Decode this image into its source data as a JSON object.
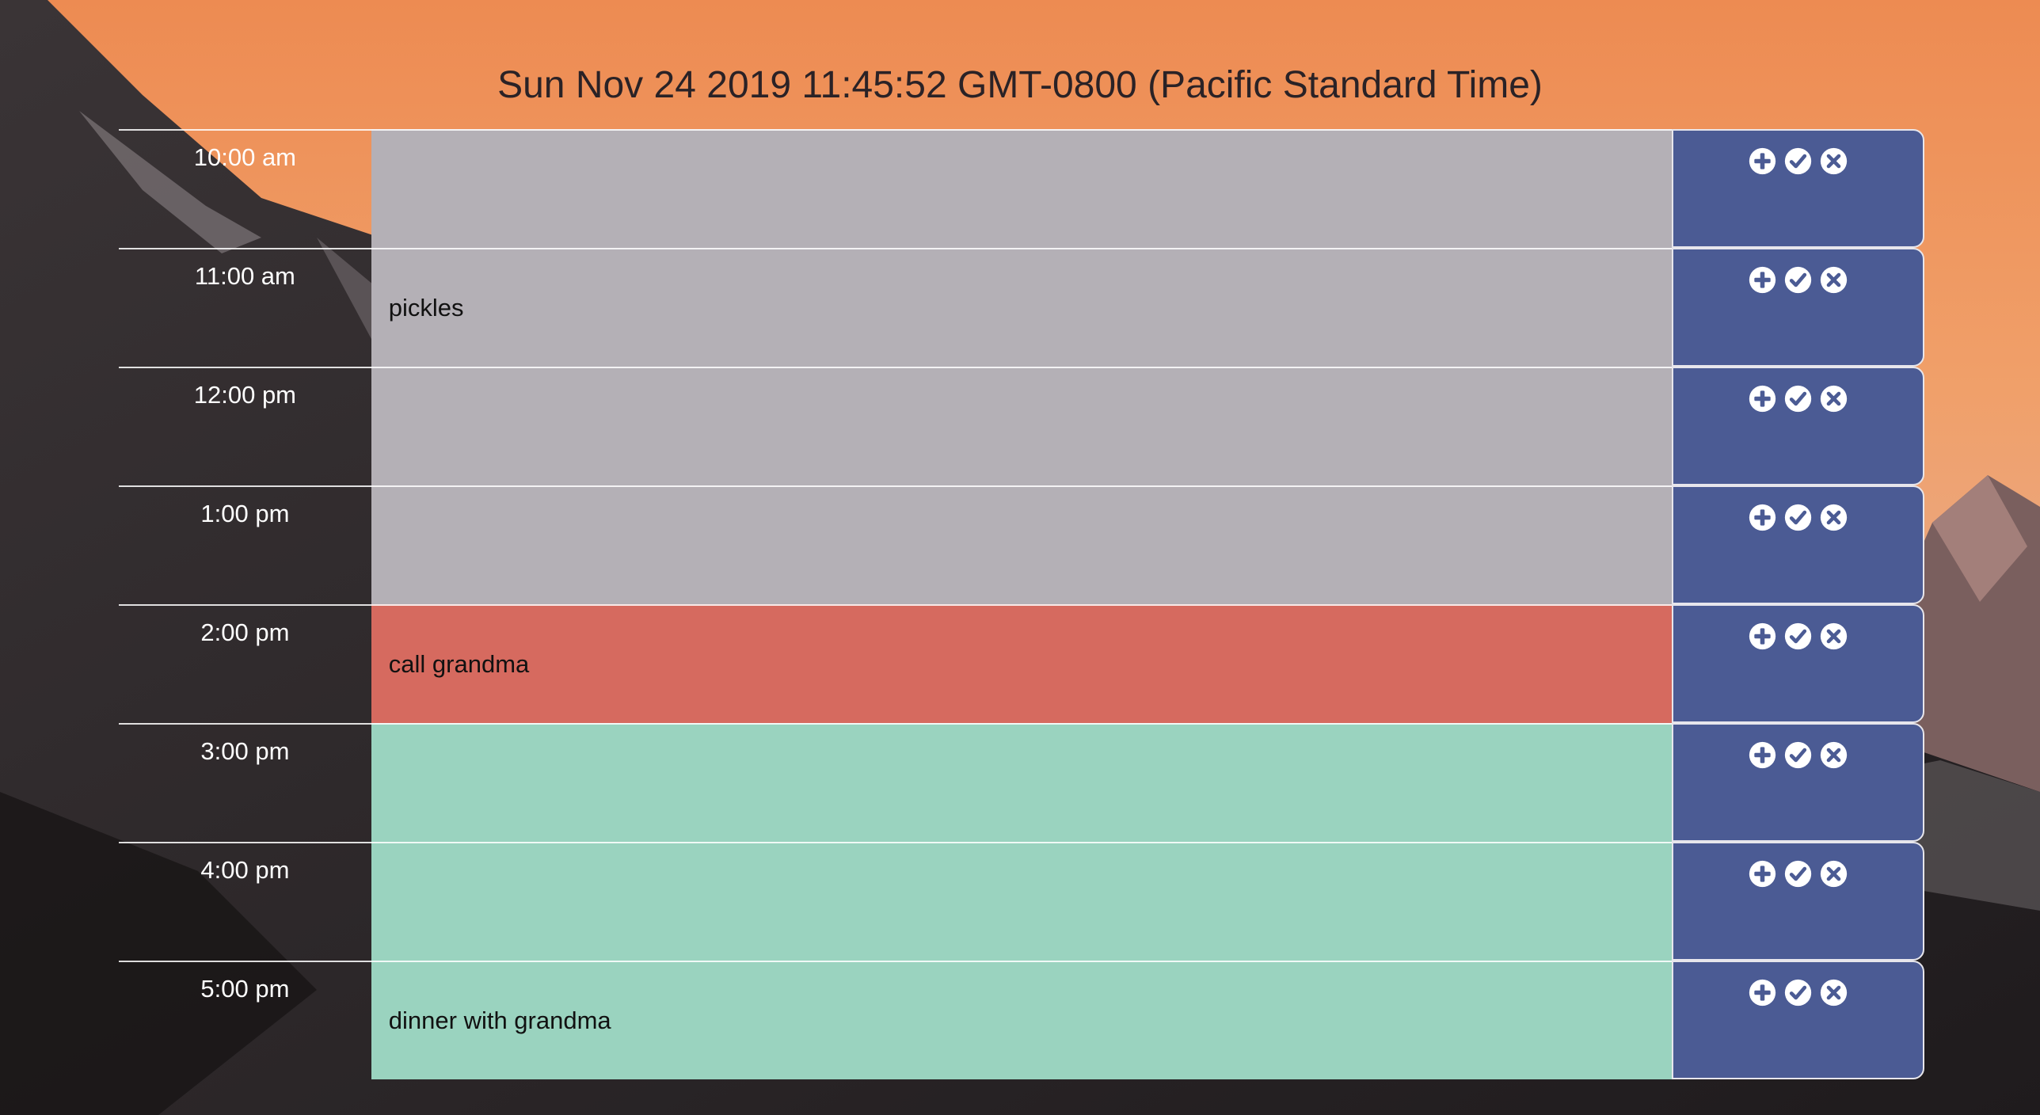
{
  "header": {
    "current_date": "Sun Nov 24 2019 11:45:52 GMT-0800 (Pacific Standard Time)"
  },
  "colors": {
    "past": "#b4b0b6",
    "present": "#d66a5f",
    "future": "#9ad3bf",
    "actions": "#4b5b94"
  },
  "icons": {
    "add": "plus-circle-icon",
    "complete": "check-circle-icon",
    "delete": "times-circle-icon"
  },
  "rows": [
    {
      "hour": "10:00 am",
      "task": "",
      "status": "past"
    },
    {
      "hour": "11:00 am",
      "task": "pickles",
      "status": "past"
    },
    {
      "hour": "12:00 pm",
      "task": "",
      "status": "past"
    },
    {
      "hour": "1:00 pm",
      "task": "",
      "status": "past"
    },
    {
      "hour": "2:00 pm",
      "task": "call grandma",
      "status": "present"
    },
    {
      "hour": "3:00 pm",
      "task": "",
      "status": "future"
    },
    {
      "hour": "4:00 pm",
      "task": "",
      "status": "future"
    },
    {
      "hour": "5:00 pm",
      "task": "dinner with grandma",
      "status": "future"
    }
  ]
}
